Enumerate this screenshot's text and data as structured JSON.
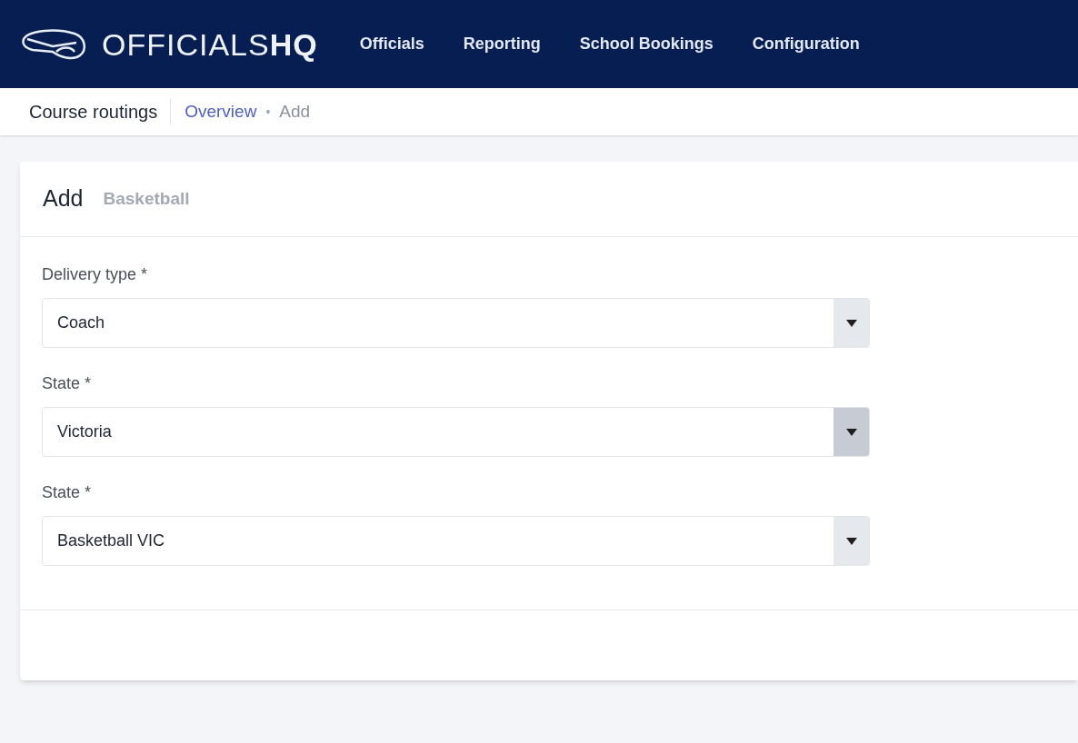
{
  "brand": {
    "light": "OFFICIALS",
    "bold": "HQ"
  },
  "nav": [
    {
      "label": "Officials"
    },
    {
      "label": "Reporting"
    },
    {
      "label": "School Bookings"
    },
    {
      "label": "Configuration"
    }
  ],
  "breadcrumb": {
    "section": "Course routings",
    "link": "Overview",
    "separator": "•",
    "current": "Add"
  },
  "card": {
    "title": "Add",
    "subtitle": "Basketball",
    "fields": [
      {
        "label": "Delivery type *",
        "value": "Coach",
        "hovered": false
      },
      {
        "label": "State *",
        "value": "Victoria",
        "hovered": true
      },
      {
        "label": "State *",
        "value": "Basketball VIC",
        "hovered": false
      }
    ]
  }
}
